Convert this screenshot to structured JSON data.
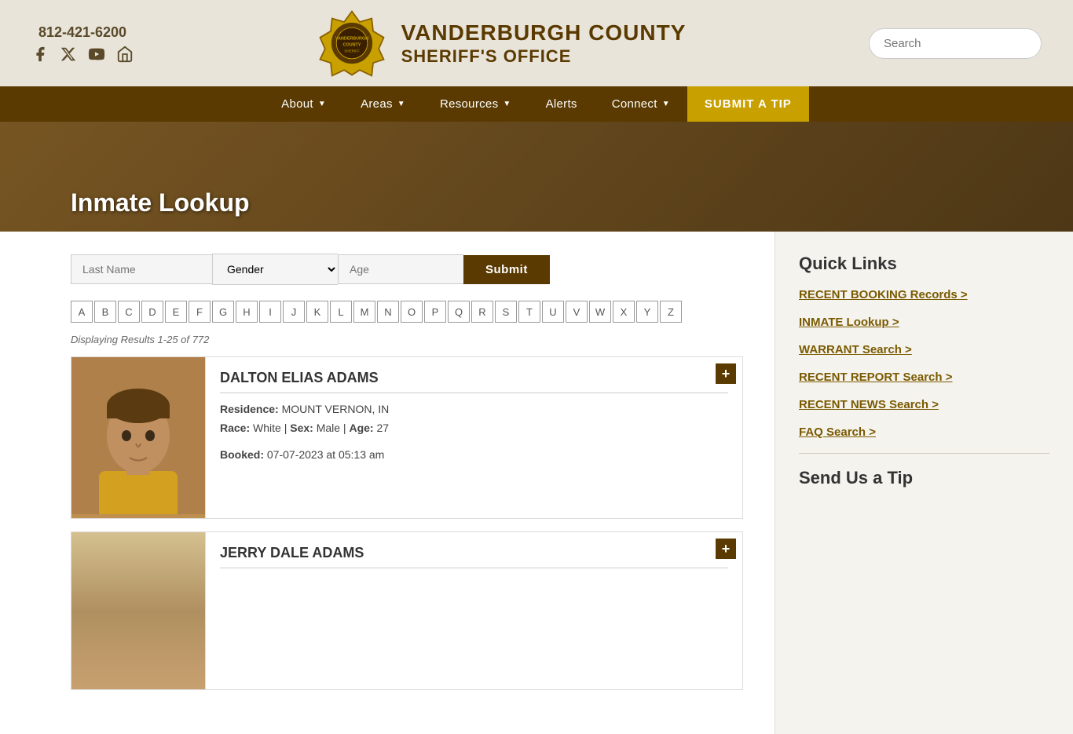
{
  "header": {
    "phone": "812-421-6200",
    "title_main": "VANDERBURGH COUNTY",
    "title_sub": "SHERIFF'S OFFICE",
    "search_placeholder": "Search"
  },
  "nav": {
    "items": [
      {
        "label": "About",
        "has_dropdown": true
      },
      {
        "label": "Areas",
        "has_dropdown": true
      },
      {
        "label": "Resources",
        "has_dropdown": true
      },
      {
        "label": "Alerts",
        "has_dropdown": false
      },
      {
        "label": "Connect",
        "has_dropdown": true
      }
    ],
    "submit_label": "SUBMIT A TIP"
  },
  "hero": {
    "title": "Inmate Lookup"
  },
  "search_form": {
    "lastname_placeholder": "Last Name",
    "gender_placeholder": "Gender",
    "age_placeholder": "Age",
    "submit_label": "Submit"
  },
  "alphabet": [
    "A",
    "B",
    "C",
    "D",
    "E",
    "F",
    "G",
    "H",
    "I",
    "J",
    "K",
    "L",
    "M",
    "N",
    "O",
    "P",
    "Q",
    "R",
    "S",
    "T",
    "U",
    "V",
    "W",
    "X",
    "Y",
    "Z"
  ],
  "results_count": "Displaying Results 1-25 of 772",
  "inmates": [
    {
      "name": "DALTON ELIAS ADAMS",
      "residence_label": "Residence:",
      "residence": "MOUNT VERNON, IN",
      "race_label": "Race:",
      "race": "White",
      "sex_label": "Sex:",
      "sex": "Male",
      "age_label": "Age:",
      "age": "27",
      "booked_label": "Booked:",
      "booked": "07-07-2023 at 05:13 am"
    },
    {
      "name": "JERRY DALE ADAMS",
      "residence_label": "",
      "residence": "",
      "race_label": "",
      "race": "",
      "sex_label": "",
      "sex": "",
      "age_label": "",
      "age": "",
      "booked_label": "",
      "booked": ""
    }
  ],
  "sidebar": {
    "quick_links_title": "Quick Links",
    "links": [
      {
        "label": "RECENT BOOKING Records >"
      },
      {
        "label": "INMATE Lookup >"
      },
      {
        "label": "WARRANT Search >"
      },
      {
        "label": "RECENT REPORT Search >"
      },
      {
        "label": "RECENT NEWS Search >"
      },
      {
        "label": "FAQ Search >"
      }
    ],
    "send_tip_title": "Send Us a Tip"
  }
}
